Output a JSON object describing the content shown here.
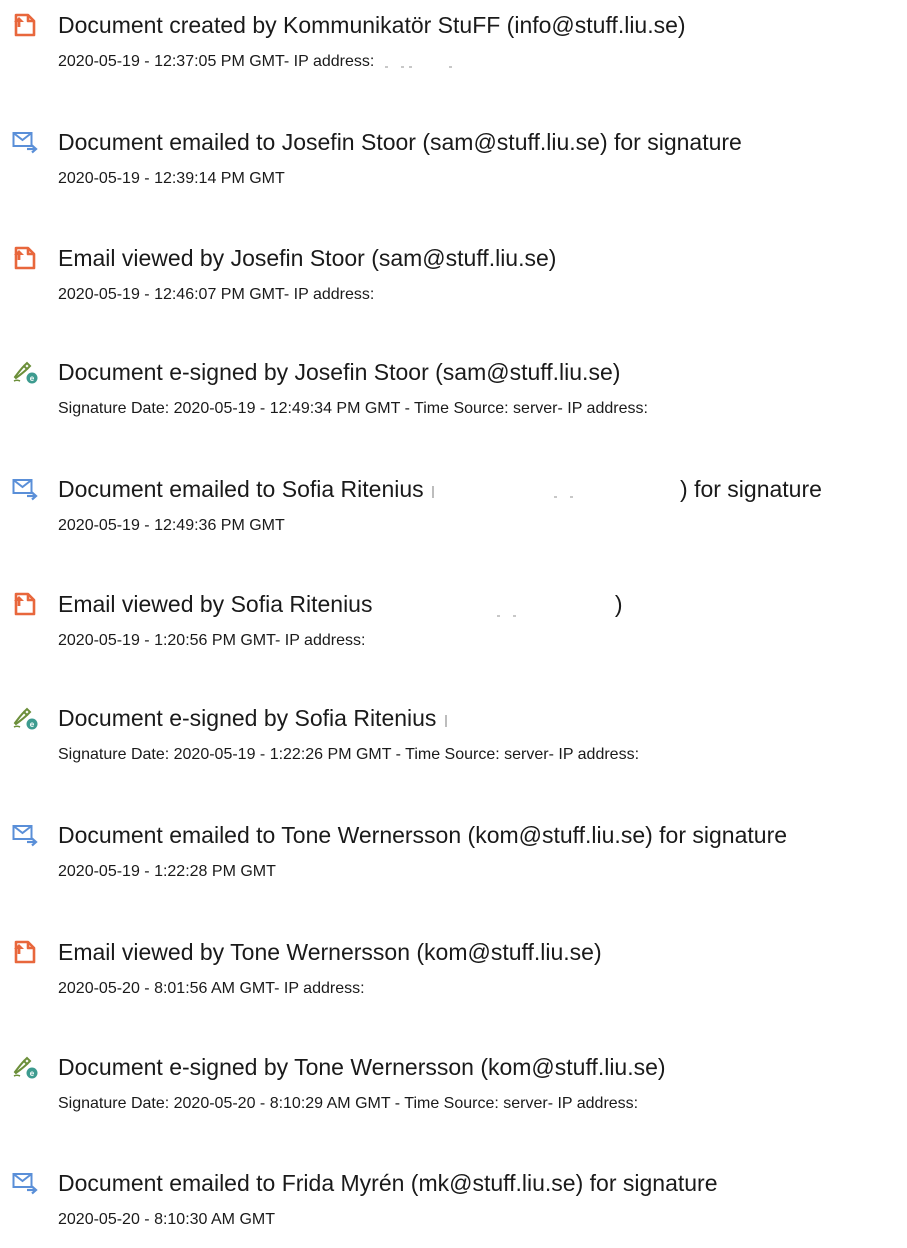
{
  "colors": {
    "doc_icon": "#e8673c",
    "mail_icon": "#5a8fd8",
    "sign_icon_pen": "#6c8f3a",
    "sign_icon_badge": "#3d9b8f",
    "text": "#1a1a1a"
  },
  "entries": [
    {
      "icon": "document-icon",
      "title": "Document created by Kommunikatör StuFF (info@stuff.liu.se)",
      "detail": "2020-05-19 - 12:37:05 PM GMT- IP address:"
    },
    {
      "icon": "envelope-arrow-icon",
      "title": "Document emailed to Josefin Stoor (sam@stuff.liu.se) for signature",
      "detail": "2020-05-19 - 12:39:14 PM GMT"
    },
    {
      "icon": "document-icon",
      "title": "Email viewed by Josefin Stoor (sam@stuff.liu.se)",
      "detail": "2020-05-19 - 12:46:07 PM GMT- IP address:"
    },
    {
      "icon": "pen-sign-icon",
      "title": "Document e-signed by Josefin Stoor (sam@stuff.liu.se)",
      "detail": "Signature Date: 2020-05-19 - 12:49:34 PM GMT - Time Source: server- IP address:"
    },
    {
      "icon": "envelope-arrow-icon",
      "title_pre": "Document emailed to Sofia Ritenius",
      "title_post": ") for signature",
      "detail": "2020-05-19 - 12:49:36 PM GMT"
    },
    {
      "icon": "document-icon",
      "title_pre": "Email viewed by Sofia Ritenius",
      "title_post": ")",
      "detail": "2020-05-19 - 1:20:56 PM GMT- IP address:"
    },
    {
      "icon": "pen-sign-icon",
      "title_pre": "Document e-signed by Sofia Ritenius",
      "detail": "Signature Date: 2020-05-19 - 1:22:26 PM GMT - Time Source: server- IP address:"
    },
    {
      "icon": "envelope-arrow-icon",
      "title": "Document emailed to Tone Wernersson (kom@stuff.liu.se) for signature",
      "detail": "2020-05-19 - 1:22:28 PM GMT"
    },
    {
      "icon": "document-icon",
      "title": "Email viewed by Tone Wernersson (kom@stuff.liu.se)",
      "detail": "2020-05-20 - 8:01:56 AM GMT- IP address:"
    },
    {
      "icon": "pen-sign-icon",
      "title": "Document e-signed by Tone Wernersson (kom@stuff.liu.se)",
      "detail": "Signature Date: 2020-05-20 - 8:10:29 AM GMT - Time Source: server- IP address:"
    },
    {
      "icon": "envelope-arrow-icon",
      "title": "Document emailed to Frida Myrén (mk@stuff.liu.se) for signature",
      "detail": "2020-05-20 - 8:10:30 AM GMT"
    }
  ]
}
